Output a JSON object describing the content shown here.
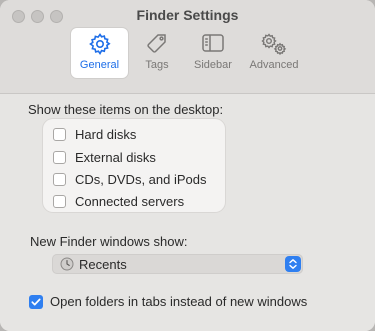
{
  "window": {
    "title": "Finder Settings"
  },
  "tabs": [
    {
      "label": "General",
      "icon": "gear-icon",
      "selected": true
    },
    {
      "label": "Tags",
      "icon": "tag-icon",
      "selected": false
    },
    {
      "label": "Sidebar",
      "icon": "sidebar-icon",
      "selected": false
    },
    {
      "label": "Advanced",
      "icon": "gears-icon",
      "selected": false
    }
  ],
  "desktop": {
    "heading": "Show these items on the desktop:",
    "items": [
      {
        "label": "Hard disks",
        "checked": false
      },
      {
        "label": "External disks",
        "checked": false
      },
      {
        "label": "CDs, DVDs, and iPods",
        "checked": false
      },
      {
        "label": "Connected servers",
        "checked": false
      }
    ]
  },
  "new_window": {
    "label": "New Finder windows show:",
    "selected": "Recents",
    "icon": "clock-icon"
  },
  "open_in_tabs": {
    "label": "Open folders in tabs instead of new windows",
    "checked": true
  },
  "colors": {
    "accent": "#2f7ff0",
    "selected_tab_text": "#1e6ee8"
  }
}
